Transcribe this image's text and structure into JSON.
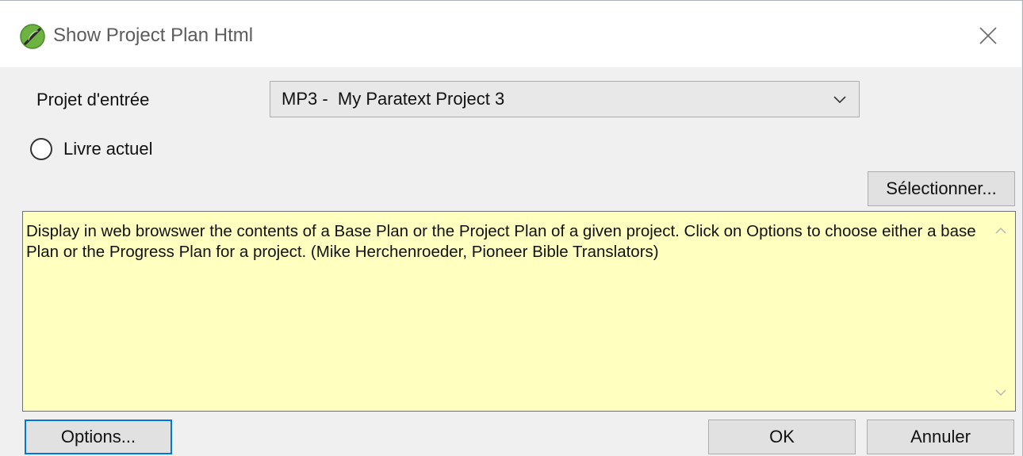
{
  "window": {
    "title": "Show Project Plan Html"
  },
  "form": {
    "input_project_label": "Projet d'entrée",
    "input_project_value": "MP3 -  My Paratext Project 3",
    "current_book_label": "Livre actuel",
    "current_book_selected": false,
    "select_button_label": "Sélectionner...",
    "description": "Display in web browswer the contents of a Base Plan or the Project Plan of a given project. Click on Options to choose either a base Plan or the Progress Plan for a project. (Mike Herchenroeder, Pioneer Bible Translators)"
  },
  "footer": {
    "options_label": "Options...",
    "ok_label": "OK",
    "cancel_label": "Annuler"
  },
  "colors": {
    "window_bg": "#f0f0f0",
    "description_bg": "#ffffc0",
    "focus_border": "#0078d7",
    "app_icon_green": "#6db33f"
  }
}
